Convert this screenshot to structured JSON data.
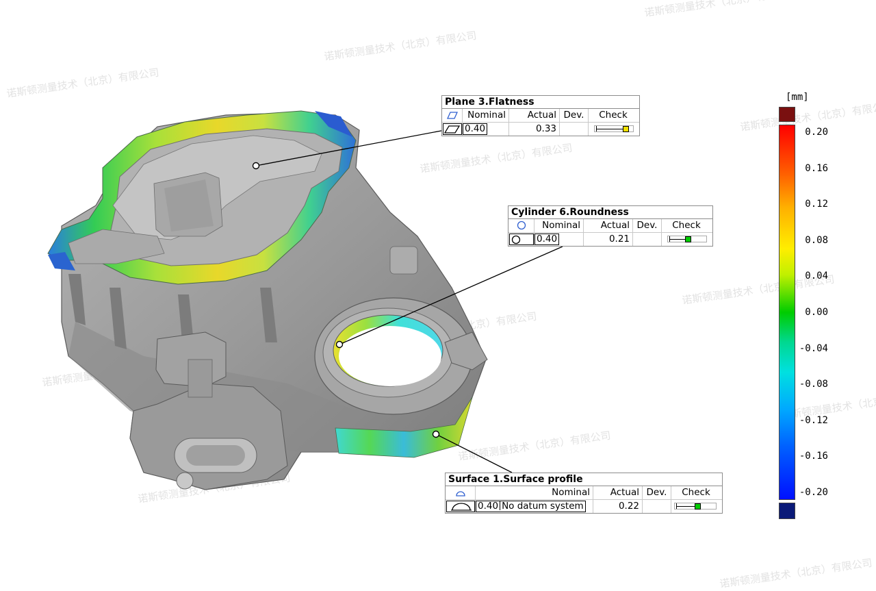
{
  "watermark": "诺斯顿测量技术（北京）有限公司",
  "callouts": {
    "flatness": {
      "title": "Plane 3.Flatness",
      "headers": {
        "nominal": "Nominal",
        "actual": "Actual",
        "dev": "Dev.",
        "check": "Check"
      },
      "values": {
        "nominal": "0.40",
        "actual": "0.33",
        "dev": ""
      },
      "check_fraction": 0.82,
      "check_color": "#f0e000",
      "symbol_icon": "flatness-parallelogram-icon"
    },
    "roundness": {
      "title": "Cylinder 6.Roundness",
      "headers": {
        "nominal": "Nominal",
        "actual": "Actual",
        "dev": "Dev.",
        "check": "Check"
      },
      "values": {
        "nominal": "0.40",
        "actual": "0.21",
        "dev": ""
      },
      "check_fraction": 0.52,
      "check_color": "#00cc00",
      "symbol_icon": "roundness-circle-icon"
    },
    "profile": {
      "title": "Surface 1.Surface profile",
      "headers": {
        "nominal": "Nominal",
        "actual": "Actual",
        "dev": "Dev.",
        "check": "Check"
      },
      "values": {
        "nominal": "0.40",
        "datum": "No datum system",
        "actual": "0.22",
        "dev": ""
      },
      "check_fraction": 0.55,
      "check_color": "#00cc00",
      "symbol_icon": "surface-profile-arc-icon"
    }
  },
  "color_scale": {
    "unit": "[mm]",
    "labels": [
      "0.20",
      "0.16",
      "0.12",
      "0.08",
      "0.04",
      "0.00",
      "-0.04",
      "-0.08",
      "-0.12",
      "-0.16",
      "-0.20"
    ],
    "overflow_color": "#7a1010",
    "underflow_color": "#0a1a78"
  }
}
